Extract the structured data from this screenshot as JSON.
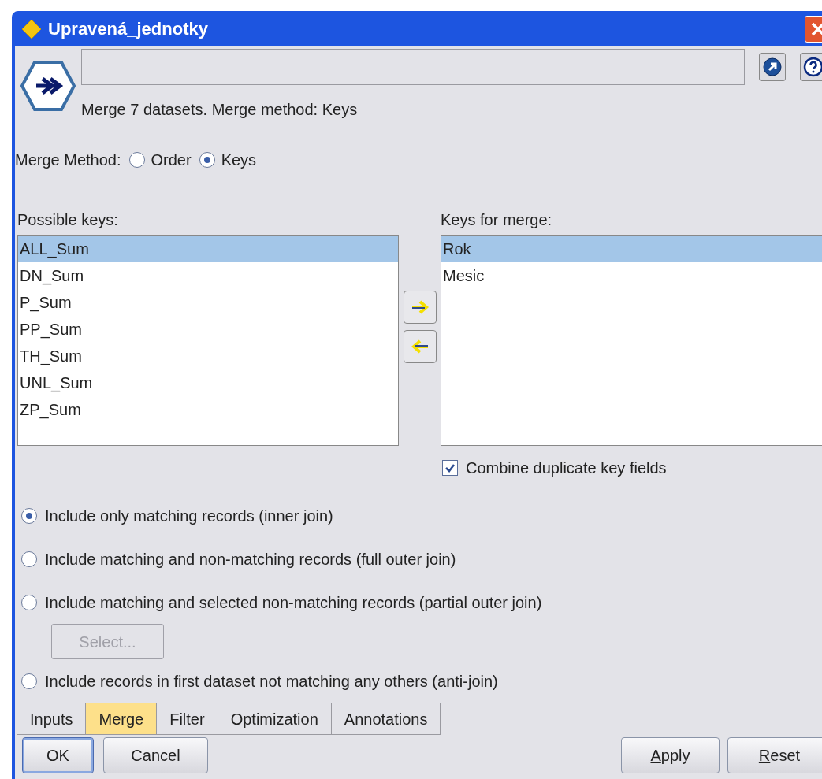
{
  "window": {
    "title": "Upravená_jednotky"
  },
  "header": {
    "description": "Merge 7 datasets. Merge method: Keys"
  },
  "merge_method": {
    "label": "Merge Method:",
    "options": [
      {
        "label": "Order",
        "selected": false
      },
      {
        "label": "Keys",
        "selected": true
      }
    ]
  },
  "possible_keys": {
    "label": "Possible keys:",
    "items": [
      {
        "label": "ALL_Sum",
        "selected": true
      },
      {
        "label": "DN_Sum",
        "selected": false
      },
      {
        "label": "P_Sum",
        "selected": false
      },
      {
        "label": "PP_Sum",
        "selected": false
      },
      {
        "label": "TH_Sum",
        "selected": false
      },
      {
        "label": "UNL_Sum",
        "selected": false
      },
      {
        "label": "ZP_Sum",
        "selected": false
      }
    ]
  },
  "keys_for_merge": {
    "label": "Keys for merge:",
    "items": [
      {
        "label": "Rok",
        "selected": true
      },
      {
        "label": "Mesic",
        "selected": false
      }
    ]
  },
  "combine_duplicates": {
    "label": "Combine duplicate key fields",
    "checked": true
  },
  "join_options": [
    {
      "label": "Include only matching records (inner join)",
      "selected": true
    },
    {
      "label": "Include matching and non-matching records (full outer join)",
      "selected": false
    },
    {
      "label": "Include matching and selected non-matching records (partial outer join)",
      "selected": false,
      "select_button": {
        "label": "Select...",
        "disabled": true
      }
    },
    {
      "label": "Include records in first dataset not matching any others (anti-join)",
      "selected": false
    }
  ],
  "tabs": [
    {
      "label": "Inputs",
      "selected": false
    },
    {
      "label": "Merge",
      "selected": true
    },
    {
      "label": "Filter",
      "selected": false
    },
    {
      "label": "Optimization",
      "selected": false
    },
    {
      "label": "Annotations",
      "selected": false
    }
  ],
  "buttons_left": [
    {
      "label": "OK",
      "default": true
    },
    {
      "label": "Cancel",
      "default": false
    }
  ],
  "buttons_right": [
    {
      "label": "Apply",
      "underlined": true
    },
    {
      "label": "Reset",
      "underlined": true
    }
  ]
}
